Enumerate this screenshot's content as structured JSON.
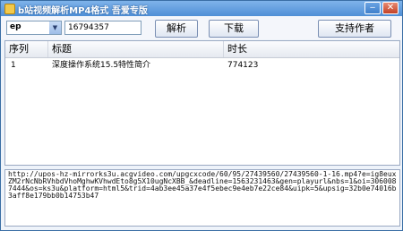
{
  "window": {
    "title": "b站视频解析MP4格式 吾爱专版",
    "minimize_icon": "minimize-icon",
    "close_icon": "close-icon"
  },
  "toolbar": {
    "prefix_select": "ep",
    "id_value": "16794357",
    "parse_label": "解析",
    "download_label": "下载",
    "support_label": "支持作者"
  },
  "table": {
    "headers": [
      "序列",
      "标题",
      "时长"
    ],
    "rows": [
      {
        "index": "1",
        "title": "深度操作系统15.5特性简介",
        "duration": "774123"
      }
    ]
  },
  "output": {
    "text": "http://upos-hz-mirrorks3u.acgvideo.com/upgcxcode/60/95/27439560/27439560-1-16.mp4?e=ig8euxZM2rNcNbRVhbdVhoMghwKVhwdEto8g5X10ugNcXBB_&deadline=1563231463&gen=playurl&nbs=1&oi=3060087444&os=ks3u&platform=html5&trid=4ab3ee45a37e4f5ebec9e4eb7e22ce84&uipk=5&upsig=32b0e74016b3aff8e179bb0b14753b47"
  },
  "colors": {
    "titlebar": "#4f8fd6",
    "window_bg": "#eef3fa",
    "accent_blue": "#0000cc"
  }
}
